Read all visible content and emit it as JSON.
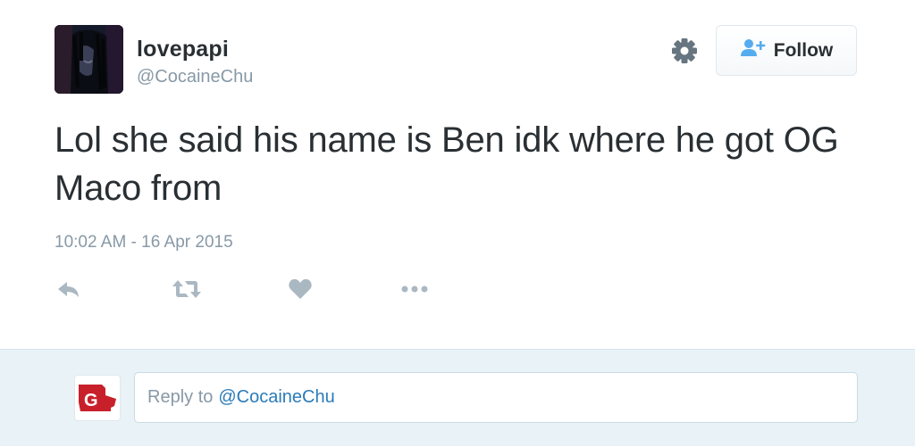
{
  "user": {
    "display_name": "lovepapi",
    "handle": "@CocaineChu"
  },
  "header": {
    "follow_label": "Follow"
  },
  "tweet": {
    "text": "Lol she said his name is Ben idk where he got OG Maco from",
    "timestamp": "10:02 AM - 16 Apr 2015"
  },
  "actions": {
    "icons": [
      "reply-icon",
      "retweet-icon",
      "heart-icon",
      "more-icon"
    ]
  },
  "reply": {
    "prefix": "Reply to",
    "handle": "@CocaineChu"
  },
  "colors": {
    "text": "#292f33",
    "muted": "#8899a6",
    "link": "#2b7bb9",
    "follow_icon": "#55acee",
    "reply_area_bg": "#e8f2f7",
    "action_icon": "#aab8c2"
  }
}
